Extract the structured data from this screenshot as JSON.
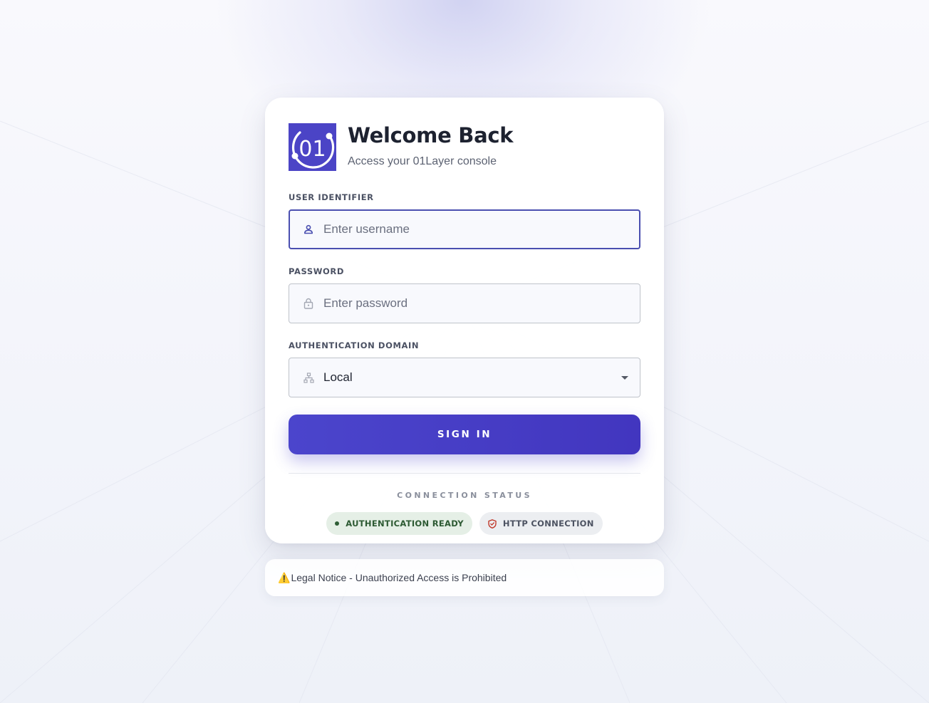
{
  "header": {
    "title": "Welcome Back",
    "subtitle": "Access your 01Layer console",
    "logo_text": "01"
  },
  "form": {
    "username": {
      "label": "USER IDENTIFIER",
      "placeholder": "Enter username",
      "value": "",
      "icon": "user-icon"
    },
    "password": {
      "label": "PASSWORD",
      "placeholder": "Enter password",
      "value": "",
      "icon": "lock-icon"
    },
    "domain": {
      "label": "AUTHENTICATION DOMAIN",
      "selected": "Local",
      "icon": "sitemap-icon"
    },
    "submit_label": "SIGN IN"
  },
  "status": {
    "title": "CONNECTION STATUS",
    "badges": [
      {
        "label": "AUTHENTICATION READY",
        "icon": "status-dot-icon",
        "color": "#2d5a33"
      },
      {
        "label": "HTTP CONNECTION",
        "icon": "shield-icon",
        "color": "#c0392b"
      }
    ]
  },
  "notice": {
    "icon": "⚠️",
    "text": "Legal Notice - Unauthorized Access is Prohibited"
  },
  "colors": {
    "accent": "#4b45cc",
    "focus_border": "#4a4fb0"
  }
}
